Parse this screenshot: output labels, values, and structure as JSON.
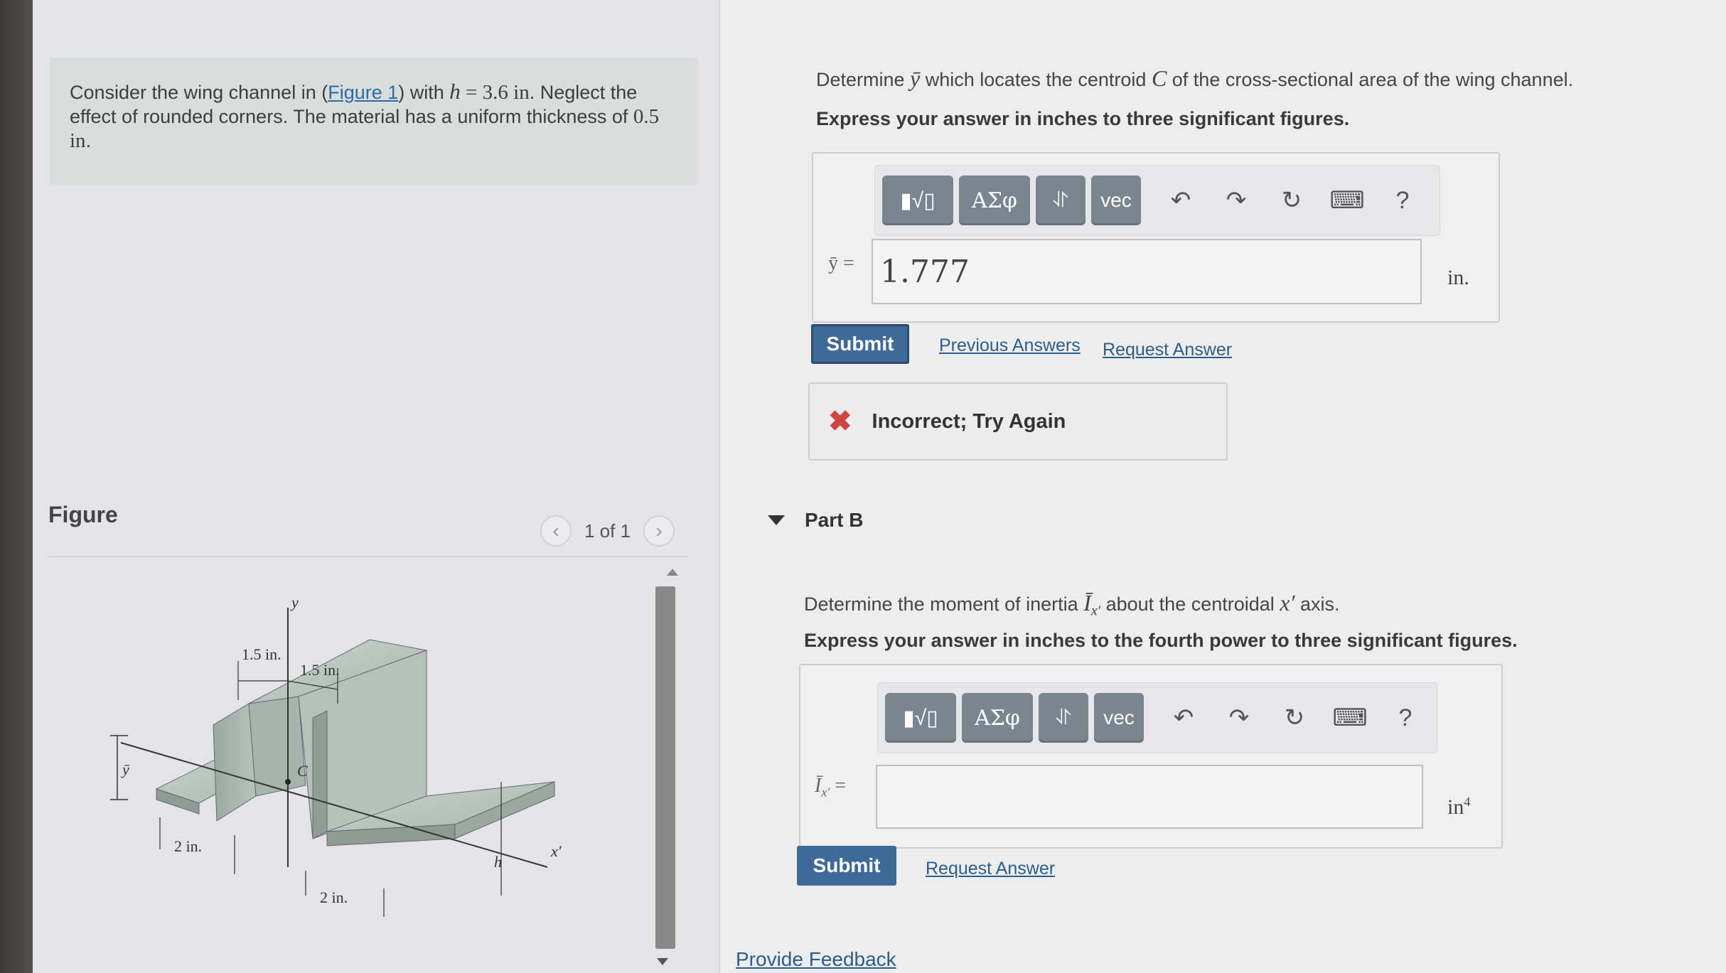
{
  "problem": {
    "text_1": "Consider the wing channel in (",
    "figure_link": "Figure 1",
    "text_2": ") with ",
    "h_symbol": "h",
    "h_value": " = 3.6 in",
    "text_3": ". Neglect the effect of rounded corners. The material has a uniform thickness of ",
    "thickness": "0.5 in",
    "text_4": "."
  },
  "figure": {
    "label": "Figure",
    "pager_text": "1 of 1",
    "prev_icon": "chevron-left-icon",
    "next_icon": "chevron-right-icon",
    "dims": {
      "y_axis": "y",
      "top_left": "1.5 in.",
      "top_right": "1.5 in.",
      "centroid": "C",
      "ybar": "ȳ",
      "left_bottom": "2 in.",
      "right_bottom": "2 in.",
      "h": "h",
      "x_prime": "x′"
    }
  },
  "part_a": {
    "question_1": "Determine ",
    "question_sym": "ȳ",
    "question_2": " which locates the centroid ",
    "question_c": "C",
    "question_3": " of the cross-sectional area of the wing channel.",
    "instruction": "Express your answer in inches to three significant figures.",
    "toolbar": {
      "b1_icon": "template-icon",
      "b2": "ΑΣφ",
      "b3": "⥯",
      "b4": "vec",
      "undo_icon": "undo-icon",
      "redo_icon": "redo-icon",
      "reset_icon": "reset-icon",
      "keyboard_icon": "keyboard-icon",
      "help": "?"
    },
    "var_label": "ȳ =",
    "input_value": "1.777",
    "unit": "in.",
    "submit": "Submit",
    "previous_answers": "Previous Answers",
    "request_answer": "Request Answer",
    "feedback": "Incorrect; Try Again"
  },
  "part_b": {
    "header": "Part B",
    "question_1": "Determine the moment of inertia ",
    "question_sym": "Ī",
    "question_sub": "x′",
    "question_2": " about the centroidal ",
    "question_axis": "x′",
    "question_3": " axis.",
    "instruction": "Express your answer in inches to the fourth power to three significant figures.",
    "var_label": "Ī",
    "var_sub": "x′",
    "var_eq": " =",
    "input_value": "",
    "unit": "in",
    "unit_exp": "4",
    "submit": "Submit",
    "request_answer": "Request Answer"
  },
  "provide_feedback": "Provide Feedback"
}
